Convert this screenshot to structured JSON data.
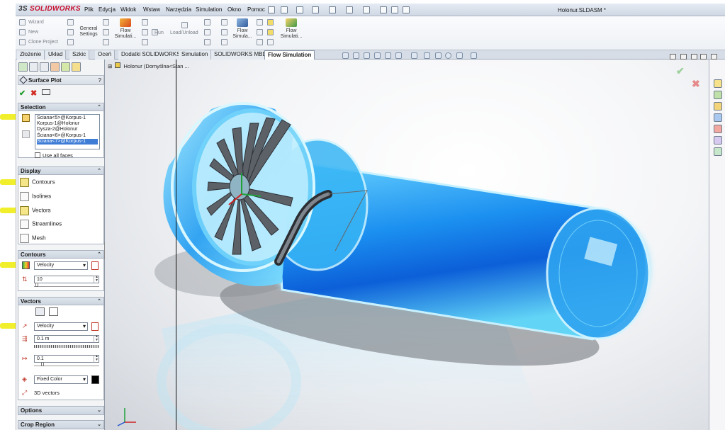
{
  "app": {
    "logo_prefix": "3S",
    "logo_name": "SOLIDWORKS",
    "document_title": "Holonur.SLDASM *"
  },
  "menu": [
    "Plik",
    "Edycja",
    "Widok",
    "Wstaw",
    "Narzędzia",
    "Simulation",
    "Okno",
    "Pomoc"
  ],
  "ribbon": {
    "wizard": "Wizard",
    "new": "New",
    "clone_project": "Clone Project",
    "general_settings": "General Settings",
    "flow_simulation_1": "Flow Simulati...",
    "run": "Run",
    "load_unload": "Load/Unload",
    "flow_simulation_2": "Flow Simula...",
    "flow_simulation_3": "Flow Simulati..."
  },
  "tabs": [
    "Złożenie",
    "Układ",
    "Szkic",
    "Oceń",
    "Dodatki SOLIDWORKS",
    "Simulation",
    "SOLIDWORKS MBD",
    "Flow Simulation"
  ],
  "active_tab": "Flow Simulation",
  "feature_tree": {
    "root_label": "Holonur  (Domyślna<Stan ..."
  },
  "property_manager": {
    "title": "Surface Plot",
    "help": "?",
    "selection": {
      "header": "Selection",
      "items": [
        "Ściana<5>@Korpus-1",
        "Korpus-1@Holonur",
        "Dysza-2@Holonur",
        "Ściana<6>@Korpus-1",
        "Ściana<7>@Korpus-1"
      ],
      "selected_index": 4,
      "use_all_faces_label": "Use all faces",
      "use_all_faces_checked": false
    },
    "display": {
      "header": "Display",
      "contours": "Contours",
      "isolines": "Isolines",
      "vectors": "Vectors",
      "streamlines": "Streamlines",
      "mesh": "Mesh"
    },
    "contours": {
      "header": "Contours",
      "parameter": "Velocity",
      "levels": "10"
    },
    "vectors": {
      "header": "Vectors",
      "parameter": "Velocity",
      "spacing": "0.1 m",
      "arrow_size": "0.1",
      "color_mode": "Fixed Color",
      "vectors_3d": "3D vectors"
    },
    "options_header": "Options",
    "crop_region_header": "Crop Region"
  },
  "colors": {
    "highlight": "#f0ec14",
    "fluid_blue": "#1aa6f0",
    "fluid_dark": "#0b5fd6",
    "active_tab_text": "#000000"
  }
}
